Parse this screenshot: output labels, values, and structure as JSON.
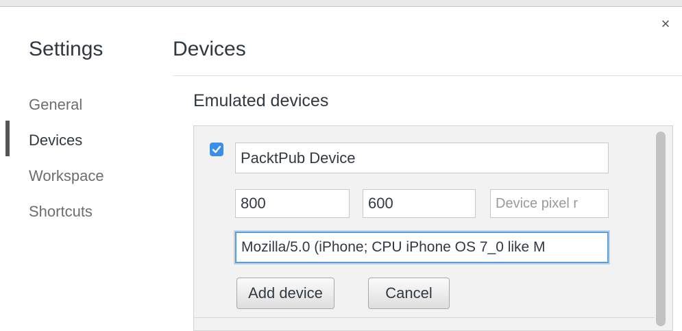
{
  "dialog": {
    "title": "Settings",
    "close_symbol": "×"
  },
  "sidebar": {
    "items": [
      {
        "label": "General",
        "active": false
      },
      {
        "label": "Devices",
        "active": true
      },
      {
        "label": "Workspace",
        "active": false
      },
      {
        "label": "Shortcuts",
        "active": false
      }
    ]
  },
  "page": {
    "title": "Devices",
    "section_title": "Emulated devices"
  },
  "device_form": {
    "enabled": true,
    "name_value": "PacktPub Device",
    "width_value": "800",
    "height_value": "600",
    "pixel_ratio_placeholder": "Device pixel r",
    "user_agent_value": "Mozilla/5.0 (iPhone; CPU iPhone OS 7_0 like M",
    "add_label": "Add device",
    "cancel_label": "Cancel"
  },
  "colors": {
    "accent": "#3b8fe9",
    "focus_ring": "#5b9dd9",
    "active_indicator": "#555555"
  },
  "icons": {
    "close": "close-icon",
    "check": "checkmark-icon"
  }
}
